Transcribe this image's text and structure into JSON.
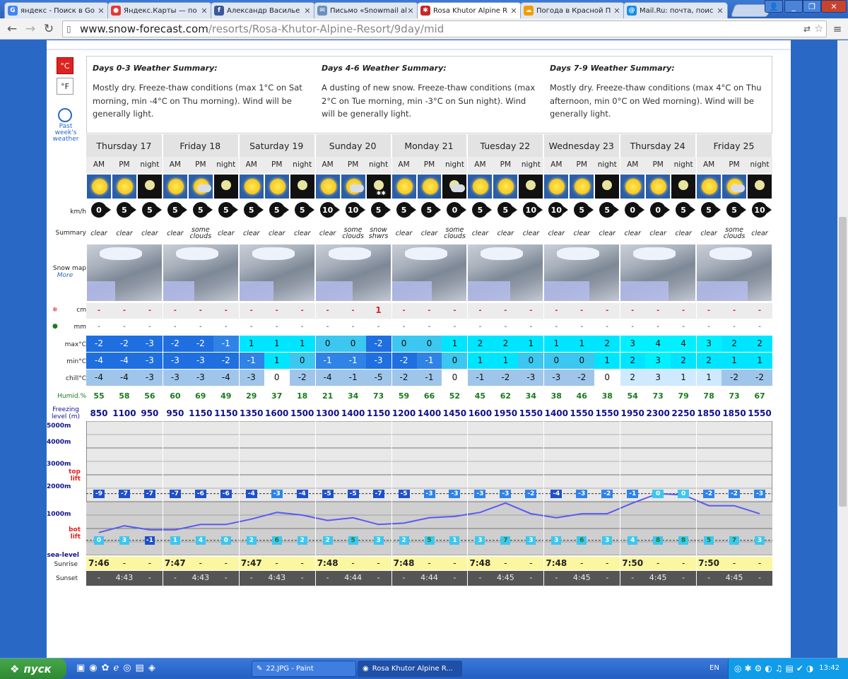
{
  "browser": {
    "tabs": [
      {
        "label": "яндекс - Поиск в Go",
        "icon": "google-icon",
        "color": "#4285f4",
        "glyph": "G"
      },
      {
        "label": "Яндекс.Карты — по",
        "icon": "map-pin-icon",
        "color": "#e53935",
        "glyph": "●"
      },
      {
        "label": "Александр Василье",
        "icon": "facebook-icon",
        "color": "#3b5998",
        "glyph": "f"
      },
      {
        "label": "Письмо «Snowmail al",
        "icon": "mail-icon",
        "color": "#6b8fbf",
        "glyph": "✉"
      },
      {
        "label": "Rosa Khutor Alpine R",
        "icon": "snowflake-icon",
        "color": "#c62828",
        "glyph": "✱"
      },
      {
        "label": "Погода в Красной П",
        "icon": "weather-icon",
        "color": "#f59b00",
        "glyph": "☁"
      },
      {
        "label": "Mail.Ru: почта, поис",
        "icon": "mailru-icon",
        "color": "#168de2",
        "glyph": "@"
      }
    ],
    "active_tab": 4,
    "url_host": "www.snow-forecast.com",
    "url_path": "/resorts/Rosa-Khutor-Alpine-Resort/9day/mid"
  },
  "units": {
    "celsius": "°C",
    "fahrenheit": "°F",
    "past_label": "Past week's weather"
  },
  "summaries": [
    {
      "title": "Days 0-3 Weather Summary:",
      "text": "Mostly dry. Freeze-thaw conditions (max 1°C on Sat morning, min -4°C on Thu morning). Wind will be generally light."
    },
    {
      "title": "Days 4-6 Weather Summary:",
      "text": "A dusting of new snow. Freeze-thaw conditions (max 2°C on Tue morning, min -3°C on Sun night). Wind will be generally light."
    },
    {
      "title": "Days 7-9 Weather Summary:",
      "text": "Mostly dry. Freeze-thaw conditions (max 4°C on Thu afternoon, min 0°C on Wed morning). Wind will be generally light."
    }
  ],
  "days": [
    "Thursday 17",
    "Friday 18",
    "Saturday 19",
    "Sunday 20",
    "Monday 21",
    "Tuesday 22",
    "Wednesday 23",
    "Thursday 24",
    "Friday 25"
  ],
  "periods": [
    "AM",
    "PM",
    "night"
  ],
  "row_labels": {
    "wind": "km/h",
    "summary": "Summary",
    "snowmap": "Snow map",
    "more": "More",
    "snow": "cm",
    "rain": "mm",
    "max": "max°C",
    "min": "min°C",
    "chill": "chill°C",
    "humid": "Humid.%",
    "freeze": "Freezing level (m)",
    "sunrise": "Sunrise",
    "sunset": "Sunset",
    "alt5000": "5000m",
    "alt4000": "4000m",
    "alt3000": "3000m",
    "alt2000": "2000m",
    "alt1000": "1000m",
    "sea": "sea-level",
    "toplift": "top lift",
    "botlift": "bot lift"
  },
  "icons": [
    "sun",
    "sun",
    "moon",
    "sun",
    "sun-cloud",
    "moon",
    "sun",
    "sun",
    "moon",
    "sun",
    "sun-cloud",
    "moon-snow",
    "sun",
    "sun",
    "moon-cloud",
    "sun",
    "sun",
    "moon",
    "sun",
    "sun",
    "moon",
    "sun",
    "sun",
    "moon",
    "sun",
    "sun-cloud",
    "moon"
  ],
  "wind": [
    "0",
    "5",
    "5",
    "5",
    "5",
    "5",
    "5",
    "5",
    "5",
    "10",
    "10",
    "5",
    "5",
    "5",
    "0",
    "5",
    "5",
    "10",
    "10",
    "5",
    "5",
    "0",
    "0",
    "5",
    "5",
    "5",
    "10"
  ],
  "summary": [
    "clear",
    "clear",
    "clear",
    "clear",
    "some clouds",
    "clear",
    "clear",
    "clear",
    "clear",
    "clear",
    "some clouds",
    "snow shwrs",
    "clear",
    "clear",
    "some clouds",
    "clear",
    "clear",
    "clear",
    "clear",
    "clear",
    "clear",
    "clear",
    "clear",
    "clear",
    "clear",
    "some clouds",
    "clear"
  ],
  "snow": [
    "-",
    "-",
    "-",
    "-",
    "-",
    "-",
    "-",
    "-",
    "-",
    "-",
    "-",
    "1",
    "-",
    "-",
    "-",
    "-",
    "-",
    "-",
    "-",
    "-",
    "-",
    "-",
    "-",
    "-",
    "-",
    "-",
    "-"
  ],
  "rain": [
    "-",
    "-",
    "-",
    "-",
    "-",
    "-",
    "-",
    "-",
    "-",
    "-",
    "-",
    "-",
    "-",
    "-",
    "-",
    "-",
    "-",
    "-",
    "-",
    "-",
    "-",
    "-",
    "-",
    "-",
    "-",
    "-",
    "-"
  ],
  "maxc": [
    "-2",
    "-2",
    "-3",
    "-2",
    "-2",
    "-1",
    "1",
    "1",
    "1",
    "0",
    "0",
    "-2",
    "0",
    "0",
    "1",
    "2",
    "2",
    "1",
    "1",
    "1",
    "2",
    "3",
    "4",
    "4",
    "3",
    "2",
    "2"
  ],
  "minc": [
    "-4",
    "-4",
    "-3",
    "-3",
    "-3",
    "-2",
    "-1",
    "1",
    "0",
    "-1",
    "-1",
    "-3",
    "-2",
    "-1",
    "0",
    "1",
    "1",
    "0",
    "0",
    "0",
    "1",
    "2",
    "3",
    "2",
    "2",
    "1",
    "1"
  ],
  "chill": [
    "-4",
    "-4",
    "-3",
    "-3",
    "-3",
    "-4",
    "-3",
    "0",
    "-2",
    "-4",
    "-1",
    "-5",
    "-2",
    "-1",
    "0",
    "-1",
    "-2",
    "-3",
    "-3",
    "-2",
    "0",
    "2",
    "3",
    "1",
    "1",
    "-2",
    "-2"
  ],
  "humid": [
    "55",
    "58",
    "56",
    "60",
    "69",
    "49",
    "29",
    "37",
    "18",
    "21",
    "34",
    "73",
    "59",
    "66",
    "52",
    "45",
    "62",
    "34",
    "38",
    "46",
    "38",
    "54",
    "73",
    "79",
    "78",
    "73",
    "67"
  ],
  "freezing": [
    "850",
    "1100",
    "950",
    "950",
    "1150",
    "1150",
    "1350",
    "1600",
    "1500",
    "1300",
    "1400",
    "1150",
    "1200",
    "1400",
    "1450",
    "1600",
    "1950",
    "1550",
    "1400",
    "1550",
    "1550",
    "1950",
    "2300",
    "2250",
    "1850",
    "1850",
    "1550"
  ],
  "toplift": [
    "-9",
    "-7",
    "-7",
    "-7",
    "-6",
    "-6",
    "-4",
    "-3",
    "-4",
    "-5",
    "-5",
    "-7",
    "-5",
    "-3",
    "-3",
    "-3",
    "-3",
    "-2",
    "-4",
    "-3",
    "-2",
    "-1",
    "0",
    "0",
    "-2",
    "-2",
    "-3"
  ],
  "botlift": [
    "0",
    "3",
    "-1",
    "1",
    "4",
    "0",
    "2",
    "6",
    "2",
    "2",
    "5",
    "3",
    "2",
    "5",
    "1",
    "3",
    "7",
    "3",
    "3",
    "6",
    "3",
    "4",
    "8",
    "8",
    "5",
    "7",
    "3"
  ],
  "sunrise": [
    "7:46",
    "-",
    "-",
    "7:47",
    "-",
    "-",
    "7:47",
    "-",
    "-",
    "7:48",
    "-",
    "-",
    "7:48",
    "-",
    "-",
    "7:48",
    "-",
    "-",
    "7:48",
    "-",
    "-",
    "7:50",
    "-",
    "-",
    "7:50",
    "-",
    "-"
  ],
  "sunset": [
    "-",
    "4:43",
    "-",
    "-",
    "4:43",
    "-",
    "-",
    "4:43",
    "-",
    "-",
    "4:44",
    "-",
    "-",
    "4:44",
    "-",
    "-",
    "4:45",
    "-",
    "-",
    "4:45",
    "-",
    "-",
    "4:45",
    "-",
    "-",
    "4:45",
    "-"
  ],
  "colors": {
    "cold": "#1f6fe0",
    "cool": "#3cc7f0",
    "mild": "#00e5ff",
    "zero": "#a8d8f0",
    "grid_bg": "#f0f0f0"
  },
  "taskbar": {
    "start": "пуск",
    "windows": [
      "22.JPG - Paint",
      "Rosa Khutor Alpine R..."
    ],
    "lang": "EN",
    "clock": "13:42"
  }
}
